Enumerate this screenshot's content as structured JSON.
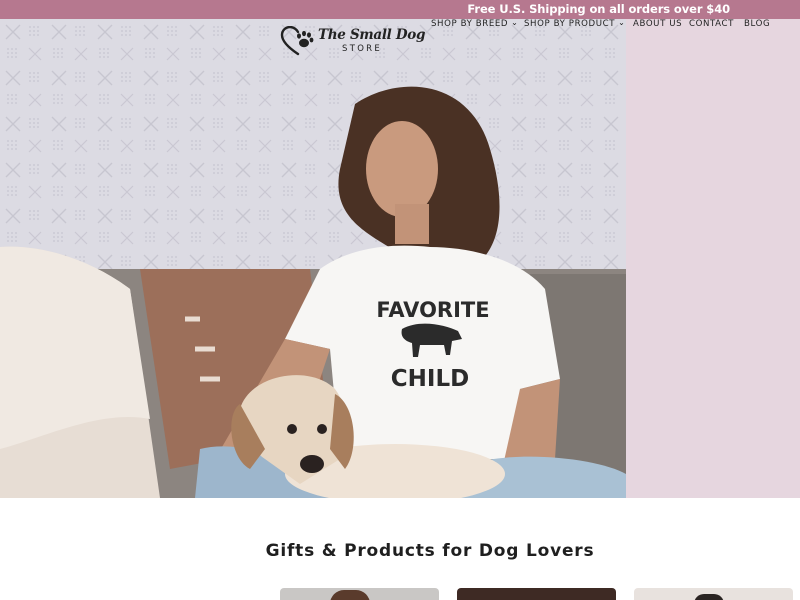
{
  "announcement": {
    "text": "Free U.S. Shipping on all orders over $40"
  },
  "logo": {
    "name": "The Small Dog",
    "tagline": "STORE"
  },
  "nav": {
    "items": [
      {
        "label": "SHOP BY BREED",
        "has_dropdown": true
      },
      {
        "label": "SHOP BY PRODUCT",
        "has_dropdown": true
      },
      {
        "label": "ABOUT US",
        "has_dropdown": false
      },
      {
        "label": "CONTACT",
        "has_dropdown": false
      },
      {
        "label": "BLOG",
        "has_dropdown": false
      }
    ]
  },
  "hero": {
    "shirt_text_top": "FAVORITE",
    "shirt_text_bottom": "CHILD"
  },
  "collection": {
    "title": "Gifts & Products for Dog Lovers"
  },
  "colors": {
    "announcement_bg": "#b6788f",
    "hero_side_bg": "#e6d6df",
    "text": "#1f1f1f"
  }
}
